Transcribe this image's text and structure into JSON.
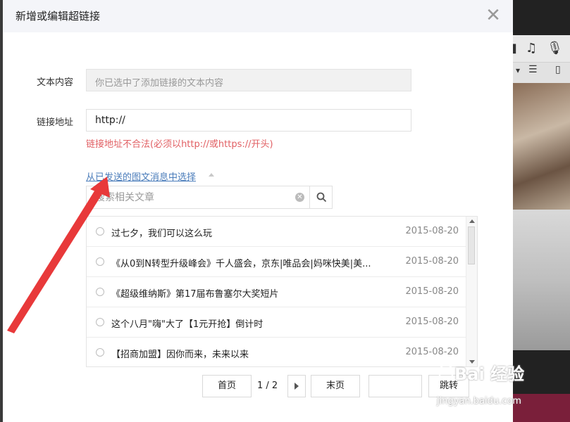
{
  "dialog": {
    "title": "新增或编辑超链接",
    "text_label": "文本内容",
    "text_value": "你已选中了添加链接的文本内容",
    "url_label": "链接地址",
    "url_value": "http://",
    "url_error": "链接地址不合法(必须以http://或https://开头)",
    "from_sent_link": "从已发送的图文消息中选择",
    "search_placeholder": "搜索相关文章",
    "close_icon": "close-icon"
  },
  "articles": [
    {
      "title": "过七夕，我们可以这么玩",
      "date": "2015-08-20"
    },
    {
      "title": "《从0到N转型升级峰会》千人盛会，京东|唯品会|妈咪快美|美...",
      "date": "2015-08-20"
    },
    {
      "title": "《超级维纳斯》第17届布鲁塞尔大奖短片",
      "date": "2015-08-20"
    },
    {
      "title": "这个八月\"嗨\"大了【1元开抢】倒计时",
      "date": "2015-08-20"
    },
    {
      "title": "【招商加盟】因你而来，未来以来",
      "date": "2015-08-20"
    }
  ],
  "pager": {
    "first_label": "首页",
    "page_info": "1 / 2",
    "last_label": "末页",
    "jump_label": "跳转"
  },
  "watermark": {
    "text": "Bai 经验",
    "url": "jingyan.baidu.com"
  },
  "colors": {
    "error": "#e15f63",
    "link": "#4a7cba",
    "annotation_arrow": "#e8393a"
  }
}
